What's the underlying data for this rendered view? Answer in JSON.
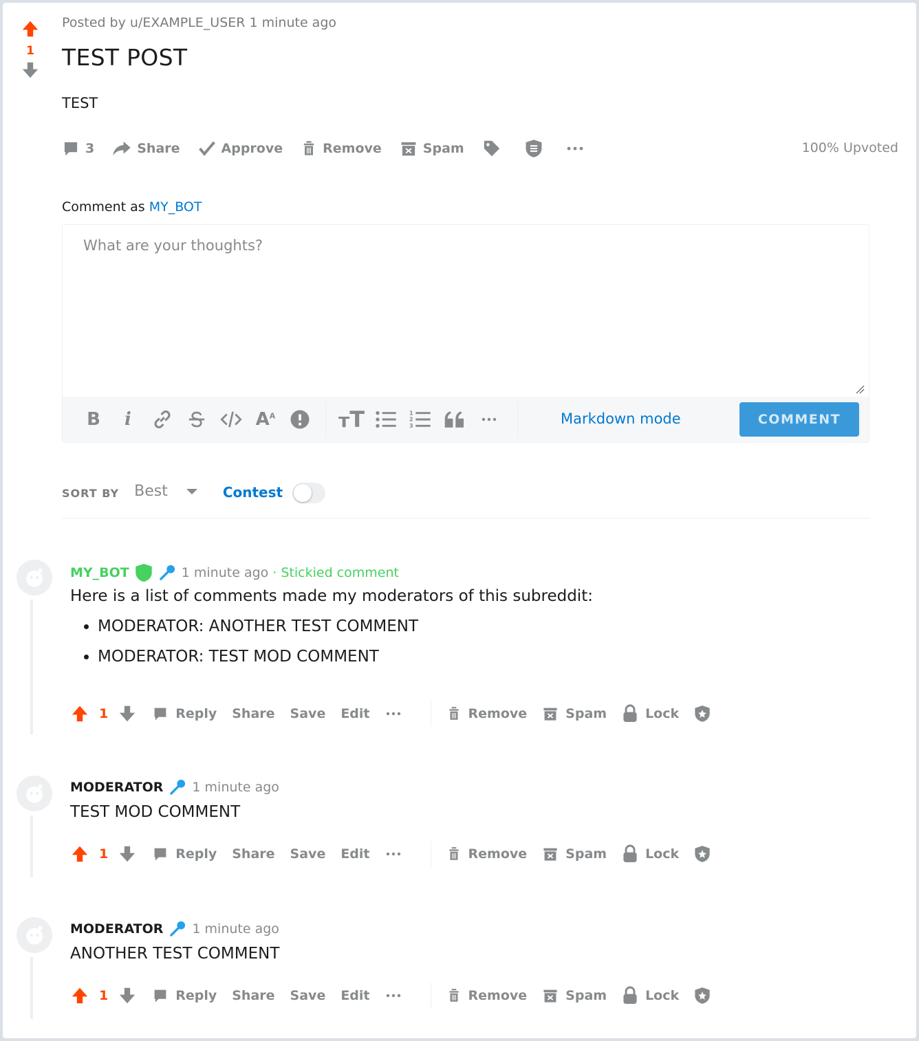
{
  "post": {
    "score": "1",
    "meta": "Posted by u/EXAMPLE_USER 1 minute ago",
    "title": "TEST POST",
    "body": "TEST",
    "comment_count": "3",
    "share_label": "Share",
    "approve_label": "Approve",
    "remove_label": "Remove",
    "spam_label": "Spam",
    "upvoted_text": "100% Upvoted"
  },
  "composer": {
    "comment_as_prefix": "Comment as",
    "comment_as_user": "MY_BOT",
    "placeholder": "What are your thoughts?",
    "markdown_mode_label": "Markdown mode",
    "submit_label": "COMMENT"
  },
  "sort": {
    "label": "SORT BY",
    "value": "Best",
    "contest_label": "Contest",
    "contest_on": false
  },
  "comment_actions": {
    "reply": "Reply",
    "share": "Share",
    "save": "Save",
    "edit": "Edit",
    "remove": "Remove",
    "spam": "Spam",
    "lock": "Lock"
  },
  "comments": [
    {
      "author": "MY_BOT",
      "time": "1 minute ago",
      "sticky_text": "· Stickied comment",
      "body": "Here is a list of comments made my moderators of this subreddit:",
      "list": [
        "MODERATOR: ANOTHER TEST COMMENT",
        "MODERATOR: TEST MOD COMMENT"
      ],
      "score": "1"
    },
    {
      "author": "MODERATOR",
      "time": "1 minute ago",
      "body": "TEST MOD COMMENT",
      "score": "1"
    },
    {
      "author": "MODERATOR",
      "time": "1 minute ago",
      "body": "ANOTHER TEST COMMENT",
      "score": "1"
    }
  ],
  "colors": {
    "upvote": "#ff4500",
    "link": "#0079d3",
    "mod_green": "#46d160",
    "mic_blue": "#24a0ed",
    "icon_gray": "#878a8c"
  }
}
